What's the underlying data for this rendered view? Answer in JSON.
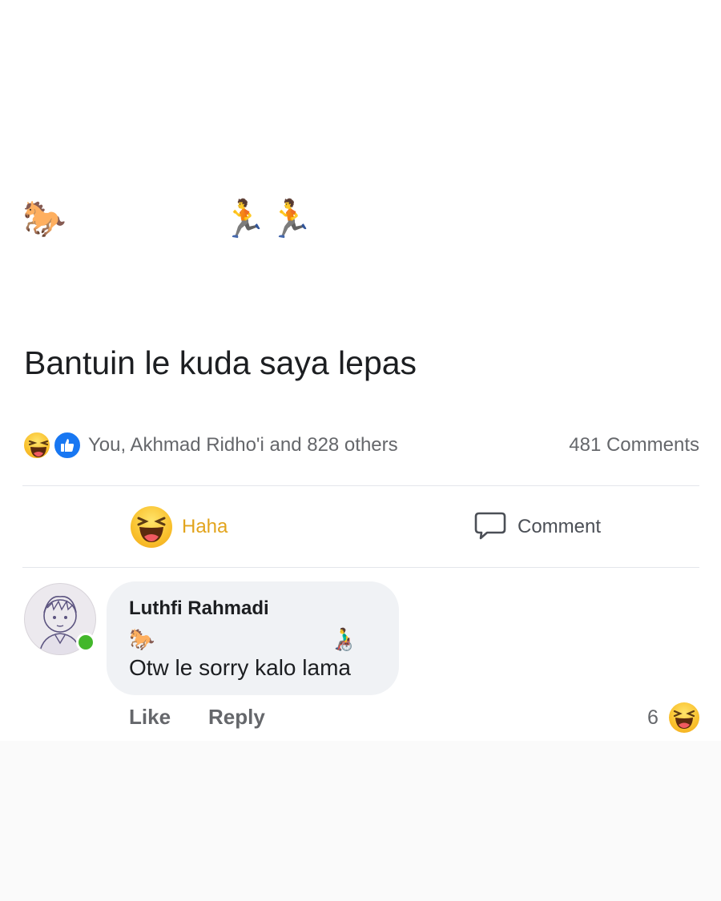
{
  "post": {
    "emoji_line": {
      "horse": "🐎",
      "runners": [
        "🏃",
        "🏃"
      ]
    },
    "text": "Bantuin le kuda saya lepas"
  },
  "reactions": {
    "icons": [
      "haha-icon",
      "like-icon"
    ],
    "summary": "You, Akhmad Ridho'i and 828 others",
    "comments_count": "481 Comments"
  },
  "actions": {
    "haha_label": "Haha",
    "comment_label": "Comment"
  },
  "comment": {
    "author": "Luthfi Rahmadi",
    "emoji_horse": "🐎",
    "emoji_wheelchair": "👨‍🦽",
    "text": "Otw le sorry kalo lama",
    "like_label": "Like",
    "reply_label": "Reply",
    "reaction_count": "6"
  },
  "colors": {
    "haha_yellow": "#f9c02c",
    "like_blue": "#1877f2",
    "online_green": "#42b72a",
    "muted_text": "#65676b",
    "bubble_bg": "#f0f2f5"
  }
}
